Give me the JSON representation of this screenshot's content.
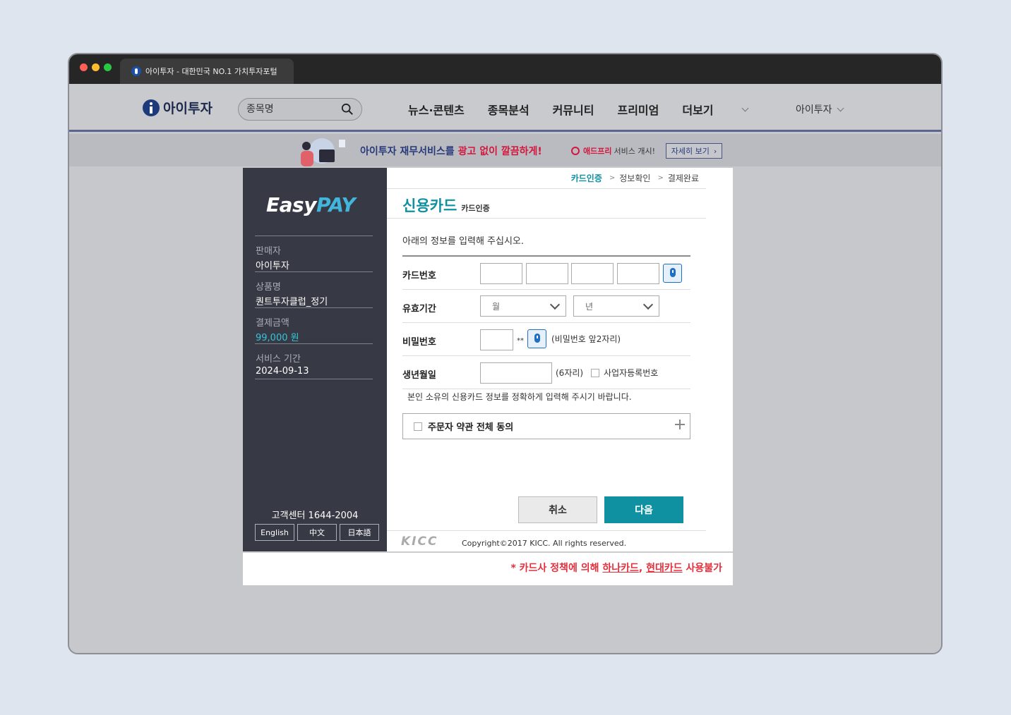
{
  "browser": {
    "tab_title": "아이투자 - 대한민국 NO.1 가치투자포털"
  },
  "site": {
    "logo_text": "아이투자",
    "search_placeholder": "종목명",
    "nav": [
      "뉴스·콘텐츠",
      "종목분석",
      "커뮤니티",
      "프리미엄",
      "더보기"
    ],
    "user_menu": "아이투자"
  },
  "banner": {
    "text_prefix": "아이투자 재무서비스를",
    "text_highlight": "광고 없이 깔끔하게!",
    "adfree_brand": "애드프리",
    "adfree_text": "서비스 개시!",
    "button": "자세히 보기"
  },
  "payment": {
    "brand_easy": "Easy",
    "brand_pay": "PAY",
    "seller_label": "판매자",
    "seller_value": "아이투자",
    "product_label": "상품명",
    "product_value": "퀀트투자클럽_정기",
    "amount_label": "결제금액",
    "amount_value": "99,000 원",
    "period_label": "서비스 기간",
    "period_value": "2024-09-13",
    "customer_center": "고객센터 1644-2004",
    "languages": [
      "English",
      "中文",
      "日本語"
    ]
  },
  "steps": [
    "카드인증",
    "정보확인",
    "결제완료"
  ],
  "form": {
    "title": "신용카드",
    "subtitle": "카드인증",
    "instruction": "아래의 정보를 입력해 주십시오.",
    "card_number_label": "카드번호",
    "expiry_label": "유효기간",
    "month_placeholder": "월",
    "year_placeholder": "년",
    "password_label": "비밀번호",
    "password_mask": "**",
    "password_hint": "(비밀번호 앞2자리)",
    "birth_label": "생년월일",
    "birth_hint": "(6자리)",
    "business_label": "사업자등록번호",
    "notice": "본인 소유의 신용카드 정보를 정확하게 입력해 주시기 바랍니다.",
    "agree_label": "주문자 약관 전체 동의",
    "cancel_button": "취소",
    "next_button": "다음"
  },
  "footer": {
    "kicc": "KICC",
    "copyright": "Copyright©2017 KICC. All rights reserved."
  },
  "warning": {
    "prefix": "* 카드사 정책에 의해 ",
    "card1": "하나카드",
    "comma": ", ",
    "card2": "현대카드",
    "suffix": " 사용불가"
  },
  "colors": {
    "accent": "#0f91a2",
    "sidebar": "#373a44",
    "warning": "#e32f3b"
  }
}
